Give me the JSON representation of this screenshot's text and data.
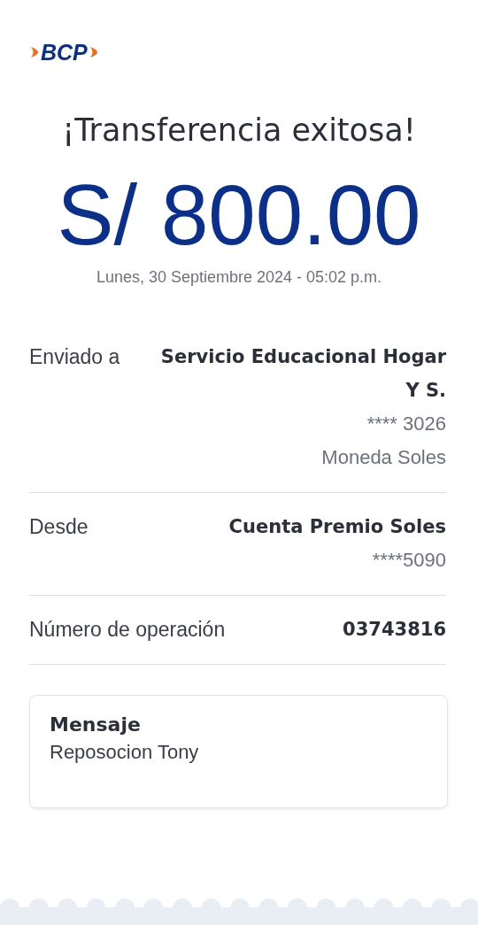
{
  "logo": {
    "text": "BCP"
  },
  "title": "¡Transferencia exitosa!",
  "amount": "S/ 800.00",
  "date": "Lunes, 30 Septiembre 2024 - 05:02 p.m.",
  "details": [
    {
      "label": "Enviado a",
      "values": [
        {
          "text": "Servicio Educacional Hogar Y S.",
          "bold": true
        },
        {
          "text": "**** 3026",
          "bold": false
        },
        {
          "text": "Moneda Soles",
          "bold": false
        }
      ]
    },
    {
      "label": "Desde",
      "values": [
        {
          "text": "Cuenta Premio Soles",
          "bold": true
        },
        {
          "text": "****5090",
          "bold": false
        }
      ]
    },
    {
      "label": "Número de operación",
      "values": [
        {
          "text": "03743816",
          "bold": true
        }
      ]
    }
  ],
  "message": {
    "title": "Mensaje",
    "text": "Reposocion Tony"
  }
}
